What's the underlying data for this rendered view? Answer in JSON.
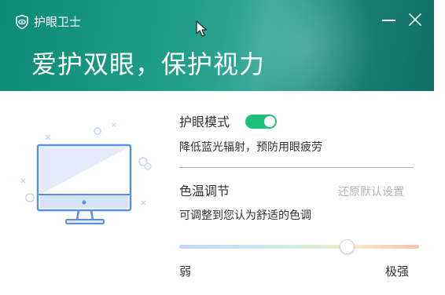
{
  "header": {
    "app_title": "护眼卫士",
    "slogan": "爱护双眼，保护视力",
    "minimize_icon": "minimize-icon",
    "close_icon": "close-icon",
    "logo_icon": "eye-shield-icon"
  },
  "eye_mode": {
    "title": "护眼模式",
    "enabled": true,
    "description": "降低蓝光辐射，预防用眼疲劳"
  },
  "color_temp": {
    "title": "色温调节",
    "reset_label": "还原默认设置",
    "description": "可调整到您认为舒适的色调",
    "min_label": "弱",
    "max_label": "极强",
    "value_fraction": 0.7
  },
  "colors": {
    "header_start": "#0c8a76",
    "header_end": "#0f6f67",
    "toggle_on": "#1fbf7a",
    "monitor_stroke": "#5b8fe0",
    "monitor_fill": "#dfe8fa"
  }
}
